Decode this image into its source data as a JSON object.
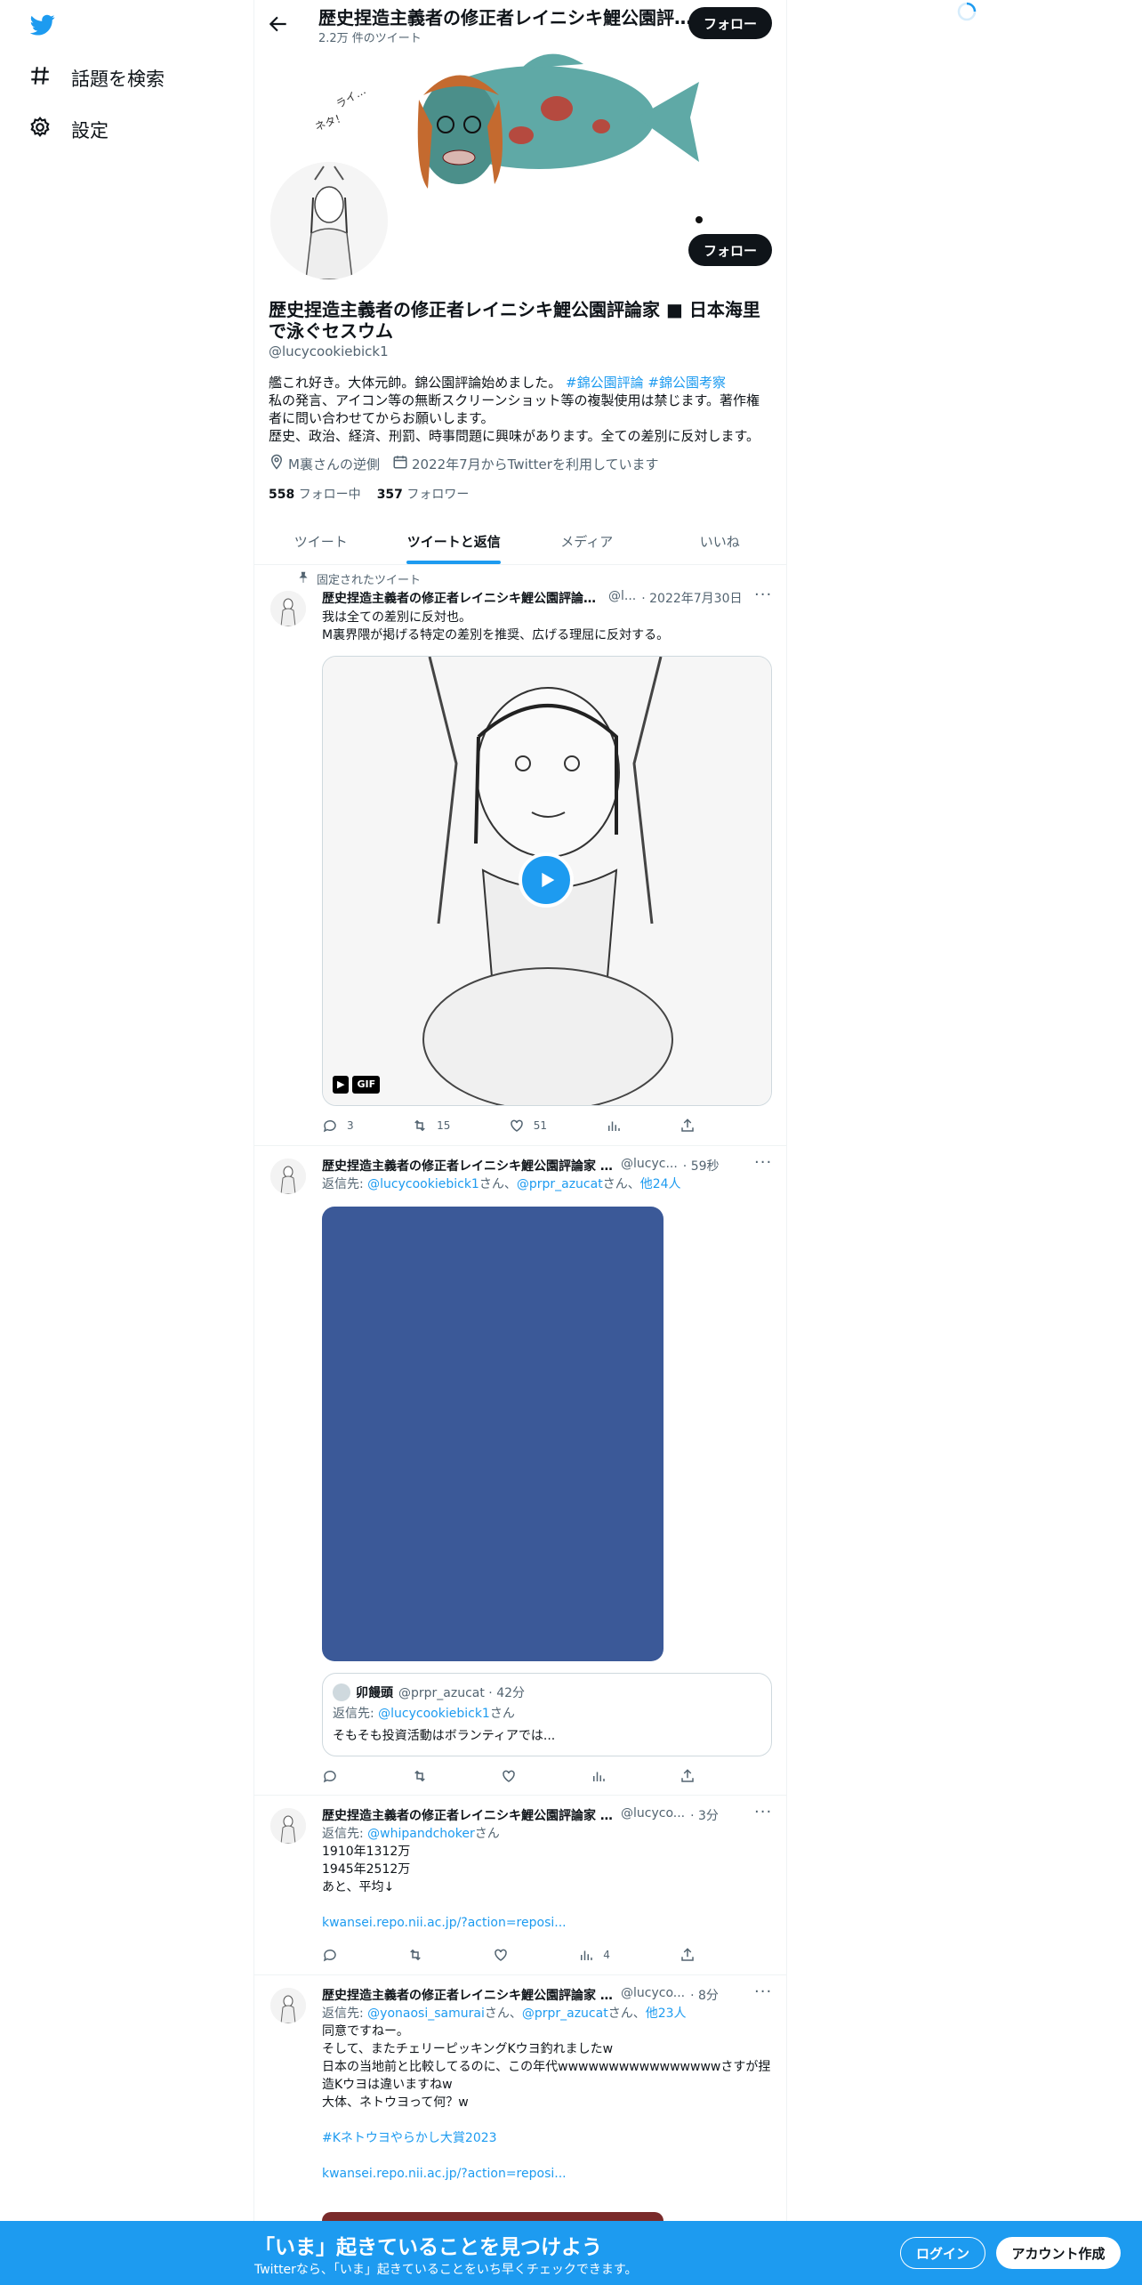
{
  "nav": {
    "explore_label": "話題を検索",
    "settings_label": "設定"
  },
  "header": {
    "title": "歴史捏造主義者の修正者レイニシキ鯉公園評論家 ■ 日本海里で泳ぐセスウム",
    "tweet_count": "2.2万 件のツイート",
    "follow_label": "フォロー"
  },
  "profile": {
    "follow_label": "フォロー",
    "name": "歴史捏造主義者の修正者レイニシキ鯉公園評論家 ■ 日本海里で泳ぐセスウム",
    "handle": "@lucycookiebick1",
    "bio_line1_prefix": "艦これ好き。大体元帥。錦公園評論始めました。",
    "bio_tag1": "#錦公園評論",
    "bio_tag2": "#錦公園考察",
    "bio_line2": "私の発言、アイコン等の無断スクリーンショット等の複製使用は禁じます。著作権者に問い合わせてからお願いします。",
    "bio_line3": "歴史、政治、経済、刑罰、時事問題に興味があります。全ての差別に反対します。",
    "location": "M裏さんの逆側",
    "joined": "2022年7月からTwitterを利用しています",
    "following_count": "558",
    "following_label": "フォロー中",
    "followers_count": "357",
    "followers_label": "フォロワー"
  },
  "tabs": [
    "ツイート",
    "ツイートと返信",
    "メディア",
    "いいね"
  ],
  "tweets": [
    {
      "pinned_label": "固定されたツイート",
      "name": "歴史捏造主義者の修正者レイニシキ鯉公園評論家 ■ 日本海里で泳ぐセスウム",
      "handle": "@l...",
      "time": "· 2022年7月30日",
      "text1": "我は全ての差別に反対也。",
      "text2": "M裏界隈が掲げる特定の差別を推奨、広げる理屈に反対する。",
      "gif_label": "GIF",
      "replies": "3",
      "retweets": "15",
      "likes": "51"
    },
    {
      "name": "歴史捏造主義者の修正者レイニシキ鯉公園評論家 ■ 日本海里で泳ぐセスウム",
      "handle": "@lucyc...",
      "time": "· 59秒",
      "reply_to_prefix": "返信先: ",
      "reply_to_1": "@lucycookiebick1",
      "reply_san_1": "さん、",
      "reply_to_2": "@prpr_azucat",
      "reply_san_2": "さん、",
      "reply_more": "他24人",
      "quote_name": "卯饅頭",
      "quote_handle": "@prpr_azucat · 42分",
      "quote_reply_prefix": "返信先: ",
      "quote_reply_to": "@lucycookiebick1",
      "quote_reply_san": "さん",
      "quote_text": "そもそも投資活動はボランティアでは..."
    },
    {
      "name": "歴史捏造主義者の修正者レイニシキ鯉公園評論家 ■ 日本海里で泳ぐセスウム",
      "handle": "@lucyco...",
      "time": "· 3分",
      "reply_to_prefix": "返信先: ",
      "reply_to_1": "@whipandchoker",
      "reply_san_1": "さん",
      "line1": "1910年1312万",
      "line2": "1945年2512万",
      "line3": "あと、平均↓",
      "link": "kwansei.repo.nii.ac.jp/?action=reposi...",
      "views": "4"
    },
    {
      "name": "歴史捏造主義者の修正者レイニシキ鯉公園評論家 ■ 日本海里で泳ぐセスウム",
      "handle": "@lucyco...",
      "time": "· 8分",
      "reply_to_prefix": "返信先: ",
      "reply_to_1": "@yonaosi_samurai",
      "reply_san_1": "さん、",
      "reply_to_2": "@prpr_azucat",
      "reply_san_2": "さん、",
      "reply_more": "他23人",
      "line1": "同意ですねー。",
      "line2": "そして、またチェリーピッキングKウヨ釣れましたw",
      "line3": "日本の当地前と比較してるのに、この年代wwwwwwwwwwwwwwwwさすが捏造Kウヨは違いますねw",
      "line4": "大体、ネトウヨって何？w",
      "hashtag": "#Kネトウヨやらかし大賞2023",
      "link": "kwansei.repo.nii.ac.jp/?action=reposi..."
    }
  ],
  "bottom_bar": {
    "title": "「いま」起きていることを見つけよう",
    "subtitle": "Twitterなら、「いま」起きていることをいち早くチェックできます。",
    "login_label": "ログイン",
    "signup_label": "アカウント作成"
  },
  "colors": {
    "accent": "#1d9bf0",
    "text": "#0f1419",
    "secondary": "#536471",
    "media_placeholder": "#3b5998"
  }
}
